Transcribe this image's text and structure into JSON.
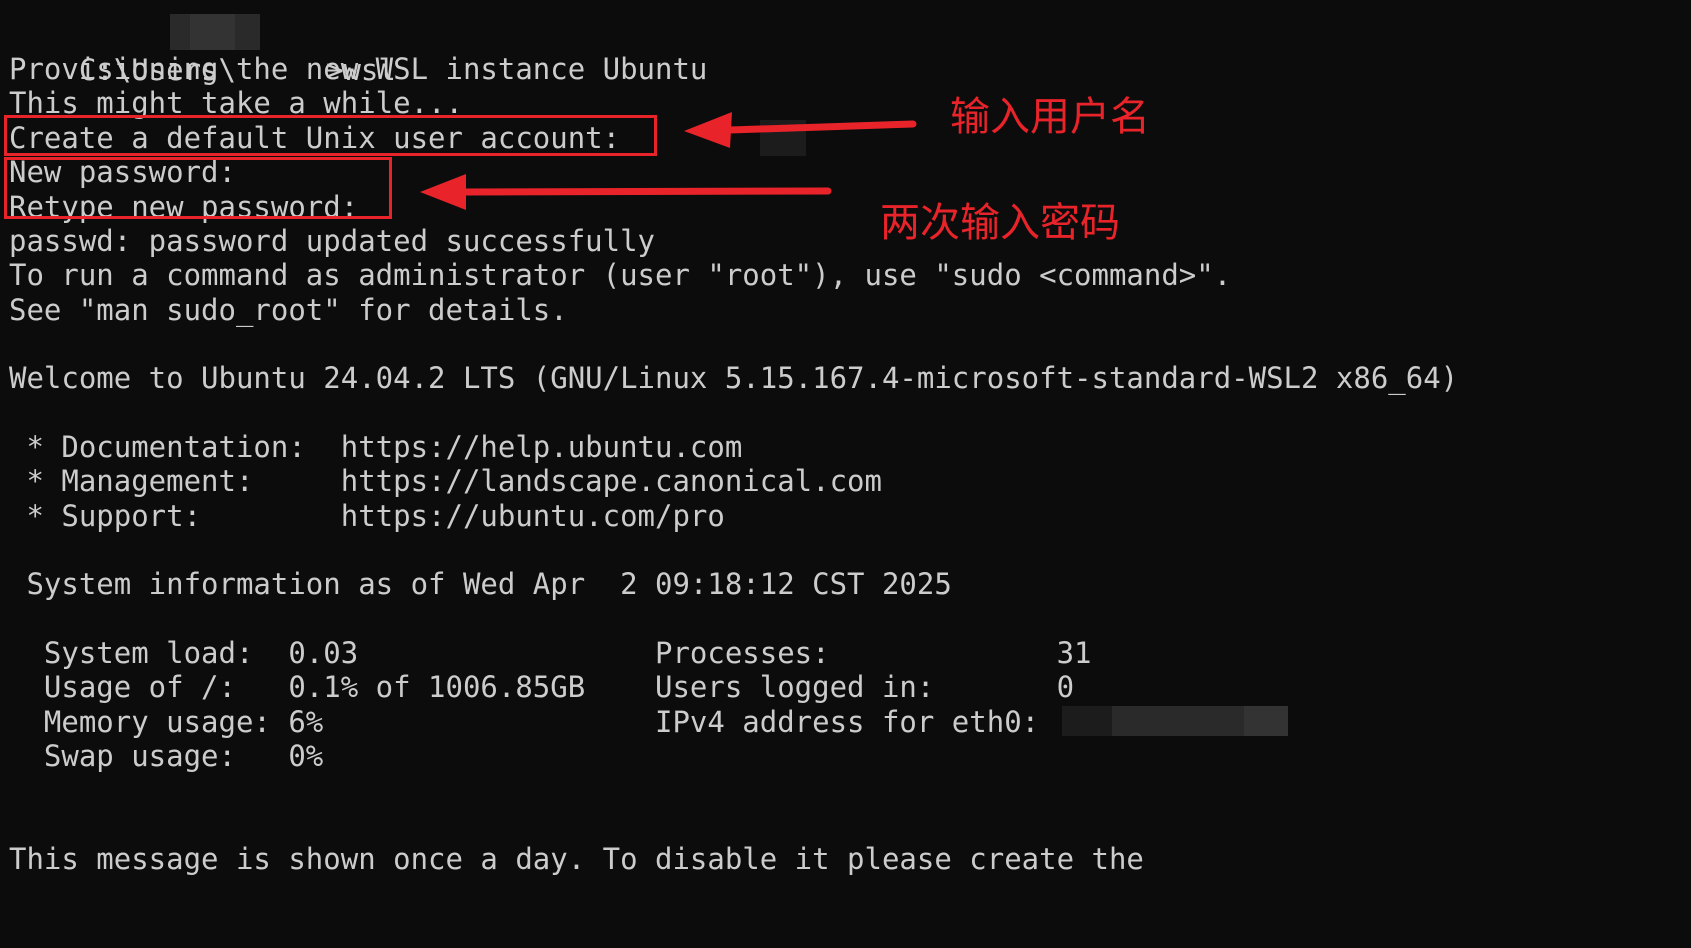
{
  "terminal": {
    "lines": {
      "prompt_prefix": "C:\\Users\\",
      "prompt_suffix": ">wsl",
      "provisioning": "Provisioning the new WSL instance Ubuntu",
      "might_take": "This might take a while...",
      "create_user": "Create a default Unix user account:",
      "new_password": "New password:",
      "retype_password": "Retype new password:",
      "passwd_updated": "passwd: password updated successfully",
      "run_as_admin": "To run a command as administrator (user \"root\"), use \"sudo <command>\".",
      "see_man": "See \"man sudo_root\" for details.",
      "welcome": "Welcome to Ubuntu 24.04.2 LTS (GNU/Linux 5.15.167.4-microsoft-standard-WSL2 x86_64)",
      "doc": " * Documentation:  https://help.ubuntu.com",
      "management": " * Management:     https://landscape.canonical.com",
      "support": " * Support:        https://ubuntu.com/pro",
      "sysinfo": " System information as of Wed Apr  2 09:18:12 CST 2025",
      "message_once": "This message is shown once a day. To disable it please create the"
    },
    "stats_left": {
      "system_load": "  System load:  0.03",
      "usage": "  Usage of /:   0.1% of 1006.85GB",
      "memory": "  Memory usage: 6%",
      "swap": "  Swap usage:   0%"
    },
    "stats_right": {
      "processes": "Processes:             31",
      "users_logged": "Users logged in:       0",
      "ipv4": "IPv4 address for eth0:"
    }
  },
  "annotations": {
    "username_note": "输入用户名",
    "password_note": "两次输入密码",
    "accent_color": "#e8232a"
  }
}
